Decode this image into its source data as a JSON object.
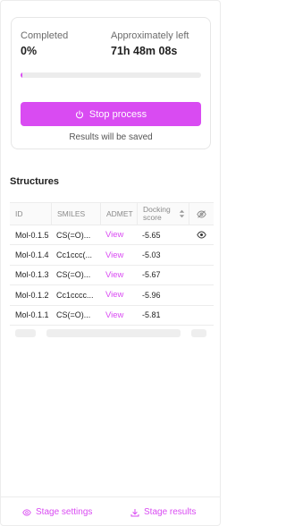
{
  "progress": {
    "completed_label": "Completed",
    "completed_value": "0%",
    "left_label": "Approximately left",
    "left_value": "71h 48m 08s",
    "fraction_complete": 0.0,
    "stop_button_label": "Stop process",
    "save_note": "Results will be saved"
  },
  "structures": {
    "title": "Structures",
    "columns": {
      "id": "ID",
      "smiles": "SMILES",
      "admet": "ADMET",
      "score_line1": "Docking",
      "score_line2": "score"
    },
    "rows": [
      {
        "id": "Mol-0.1.5",
        "smiles": "CS(=O)...",
        "admet": "View",
        "score": "-5.65",
        "visible": true
      },
      {
        "id": "Mol-0.1.4",
        "smiles": "Cc1ccc(...",
        "admet": "View",
        "score": "-5.03",
        "visible": false
      },
      {
        "id": "Mol-0.1.3",
        "smiles": "CS(=O)...",
        "admet": "View",
        "score": "-5.67",
        "visible": false
      },
      {
        "id": "Mol-0.1.2",
        "smiles": "Cc1cccc...",
        "admet": "View",
        "score": "-5.96",
        "visible": false
      },
      {
        "id": "Mol-0.1.1",
        "smiles": "CS(=O)...",
        "admet": "View",
        "score": "-5.81",
        "visible": false
      }
    ]
  },
  "footer": {
    "stage_settings_label": "Stage settings",
    "stage_results_label": "Stage results"
  },
  "colors": {
    "accent": "#d94bf2"
  },
  "icons": {
    "stop": "power-icon",
    "sort": "sort-icon",
    "visibility_header": "eye-off-icon",
    "visibility_row": "eye-icon",
    "settings": "eye-icon",
    "results": "download-icon"
  }
}
